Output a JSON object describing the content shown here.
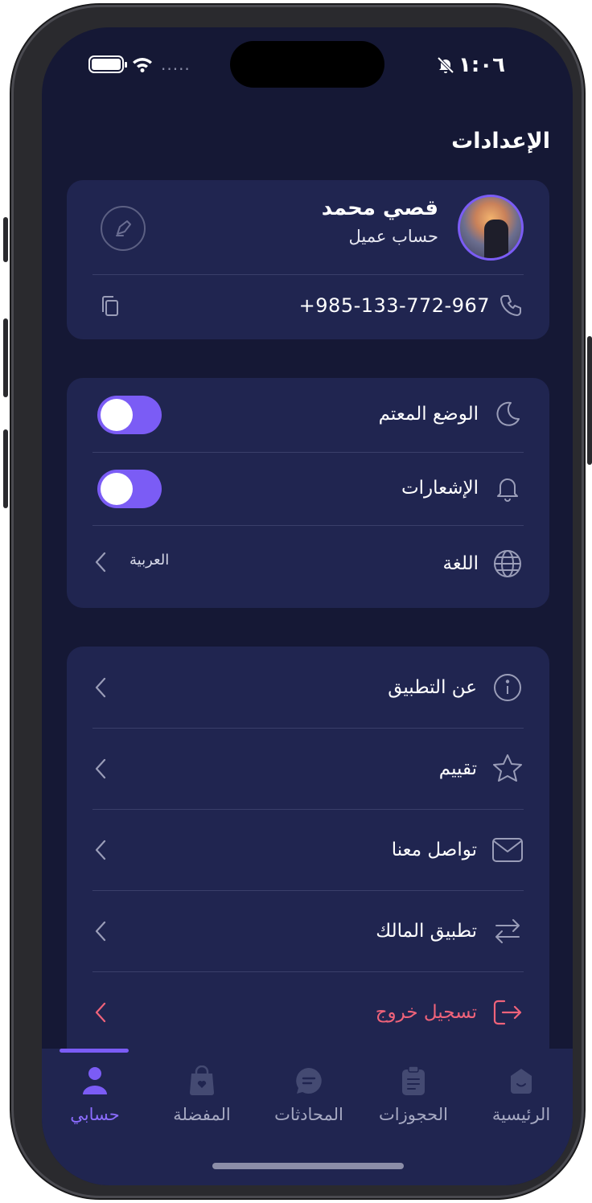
{
  "status_bar": {
    "time": "١:٠٦",
    "signal_dots": "....."
  },
  "header": {
    "title": "الإعدادات"
  },
  "profile": {
    "name": "قصي محمد",
    "account_type": "حساب عميل",
    "phone": "+985-133-772-967"
  },
  "settings": {
    "dark_mode_label": "الوضع المعتم",
    "dark_mode_on": true,
    "notifications_label": "الإشعارات",
    "notifications_on": true,
    "language_label": "اللغة",
    "language_value": "العربية"
  },
  "menu": {
    "about_label": "عن التطبيق",
    "rate_label": "تقييم",
    "contact_label": "تواصل معنا",
    "owner_app_label": "تطبيق المالك",
    "logout_label": "تسجيل خروج"
  },
  "tabbar": {
    "home": "الرئيسية",
    "bookings": "الحجوزات",
    "chats": "المحادثات",
    "favorites": "المفضلة",
    "account": "حسابي",
    "active": "account"
  },
  "colors": {
    "accent": "#7b5cf5",
    "danger": "#f0637a",
    "card": "#202550",
    "background": "#151835"
  }
}
